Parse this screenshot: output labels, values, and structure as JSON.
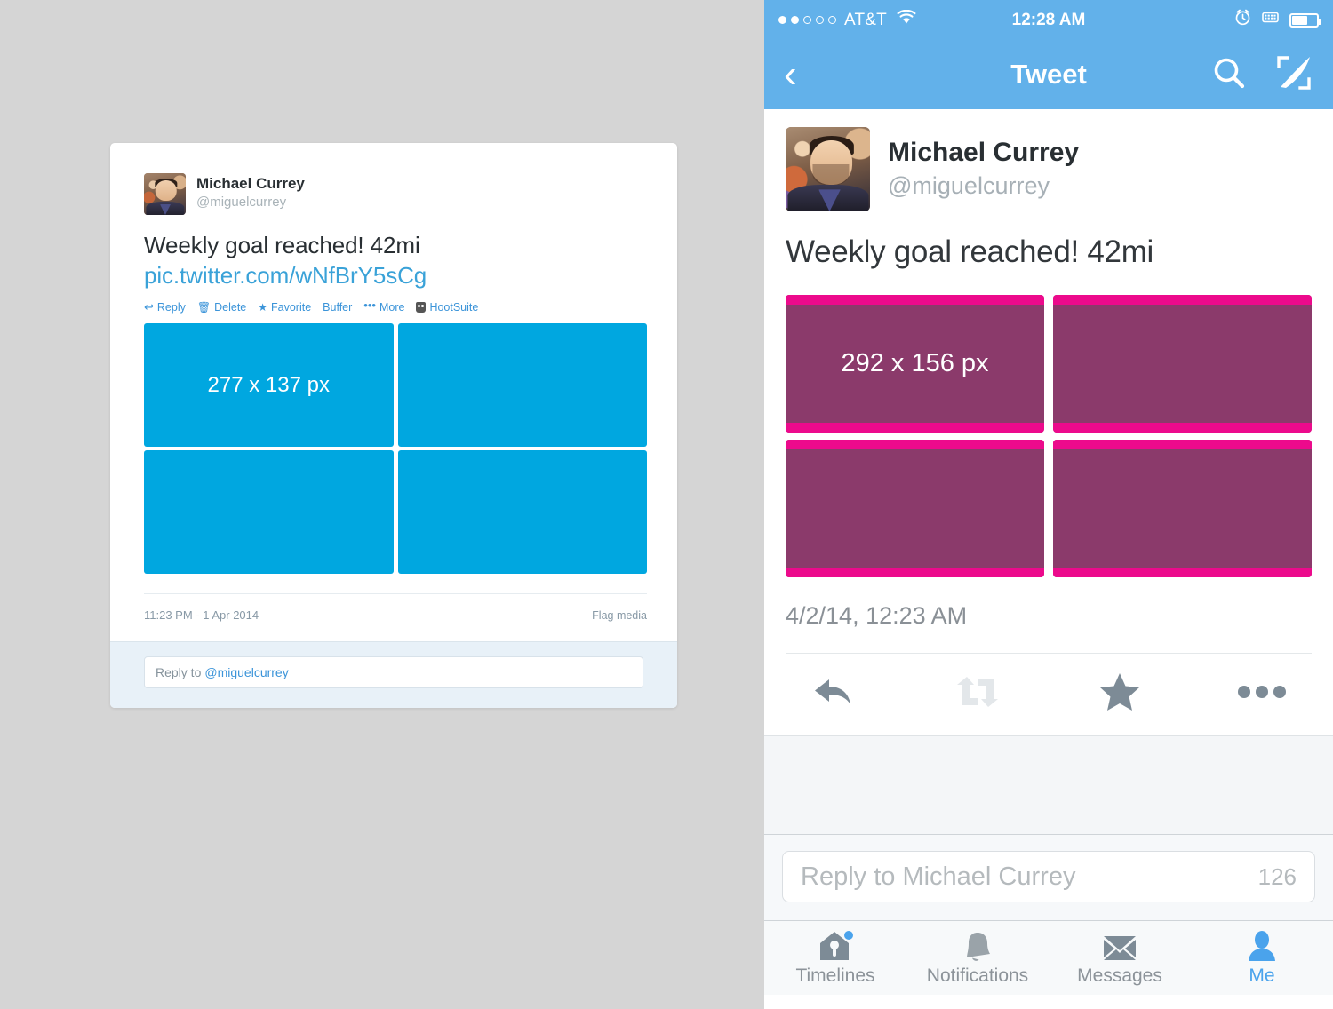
{
  "desktop": {
    "user": {
      "fullname": "Michael Currey",
      "handle": "@miguelcurrey",
      "avatar_icon": "user-avatar-photo"
    },
    "tweet": {
      "text": "Weekly goal reached! 42mi",
      "link": "pic.twitter.com/wNfBrY5sCg"
    },
    "actions": [
      {
        "label": "Reply",
        "icon": "reply-arrow-icon",
        "glyph": "↩"
      },
      {
        "label": "Delete",
        "icon": "trash-icon",
        "glyph": "🗑"
      },
      {
        "label": "Favorite",
        "icon": "star-icon",
        "glyph": "★"
      },
      {
        "label": "Buffer",
        "icon": "buffer-icon",
        "glyph": ""
      },
      {
        "label": "More",
        "icon": "ellipsis-icon",
        "glyph": "•••"
      },
      {
        "label": "HootSuite",
        "icon": "hootsuite-owl-icon",
        "glyph": ""
      }
    ],
    "media": {
      "placeholder_label": "277 x 137 px",
      "tile_color": "#00a7e0",
      "tiles": [
        "277 x 137 px",
        "",
        "",
        ""
      ]
    },
    "timestamp": "11:23 PM - 1 Apr 2014",
    "flag_label": "Flag media",
    "reply": {
      "prefix": "Reply to",
      "mention": "@miguelcurrey"
    }
  },
  "mobile": {
    "statusbar": {
      "signal_dots_filled": 2,
      "signal_dots_total": 5,
      "carrier": "AT&T",
      "wifi_icon": "wifi-icon",
      "time": "12:28 AM",
      "alarm_icon": "alarm-clock-icon",
      "rotation_icon": "rotation-lock-icon",
      "battery_icon": "battery-icon",
      "battery_level": "58%"
    },
    "navbar": {
      "back_icon": "chevron-left-icon",
      "back_glyph": "‹",
      "title": "Tweet",
      "search_icon": "search-icon",
      "compose_icon": "compose-quill-icon"
    },
    "user": {
      "fullname": "Michael Currey",
      "handle": "@miguelcurrey",
      "avatar_icon": "user-avatar-photo"
    },
    "tweet": {
      "text": "Weekly goal reached! 42mi"
    },
    "media": {
      "placeholder_label": "292 x 156 px",
      "tile_fill_color": "#8b3a6b",
      "tile_band_color": "#ec0a8c",
      "tiles": [
        "292 x 156 px",
        "",
        "",
        ""
      ]
    },
    "timestamp": "4/2/14, 12:23 AM",
    "actions": [
      {
        "name": "reply",
        "icon": "reply-arrow-icon",
        "color": "#7d8b96"
      },
      {
        "name": "retweet",
        "icon": "retweet-icon",
        "color": "#e3e7ea"
      },
      {
        "name": "favorite",
        "icon": "star-icon",
        "color": "#7d8b96"
      },
      {
        "name": "more",
        "icon": "ellipsis-icon",
        "color": "#7d8b96"
      }
    ],
    "reply": {
      "placeholder": "Reply to Michael Currey",
      "char_count": "126"
    },
    "tabs": [
      {
        "label": "Timelines",
        "icon": "birdhouse-icon",
        "active": false,
        "badge": true
      },
      {
        "label": "Notifications",
        "icon": "bell-icon",
        "active": false,
        "badge": false
      },
      {
        "label": "Messages",
        "icon": "envelope-icon",
        "active": false,
        "badge": false
      },
      {
        "label": "Me",
        "icon": "person-icon",
        "active": true,
        "badge": false
      }
    ]
  },
  "colors": {
    "ios_blue": "#62b1ea",
    "twitter_blue": "#3b94d9",
    "desktop_tile": "#00a7e0",
    "mobile_tile_fill": "#8b3a6b",
    "mobile_tile_band": "#ec0a8c",
    "page_bg": "#d5d5d5"
  }
}
